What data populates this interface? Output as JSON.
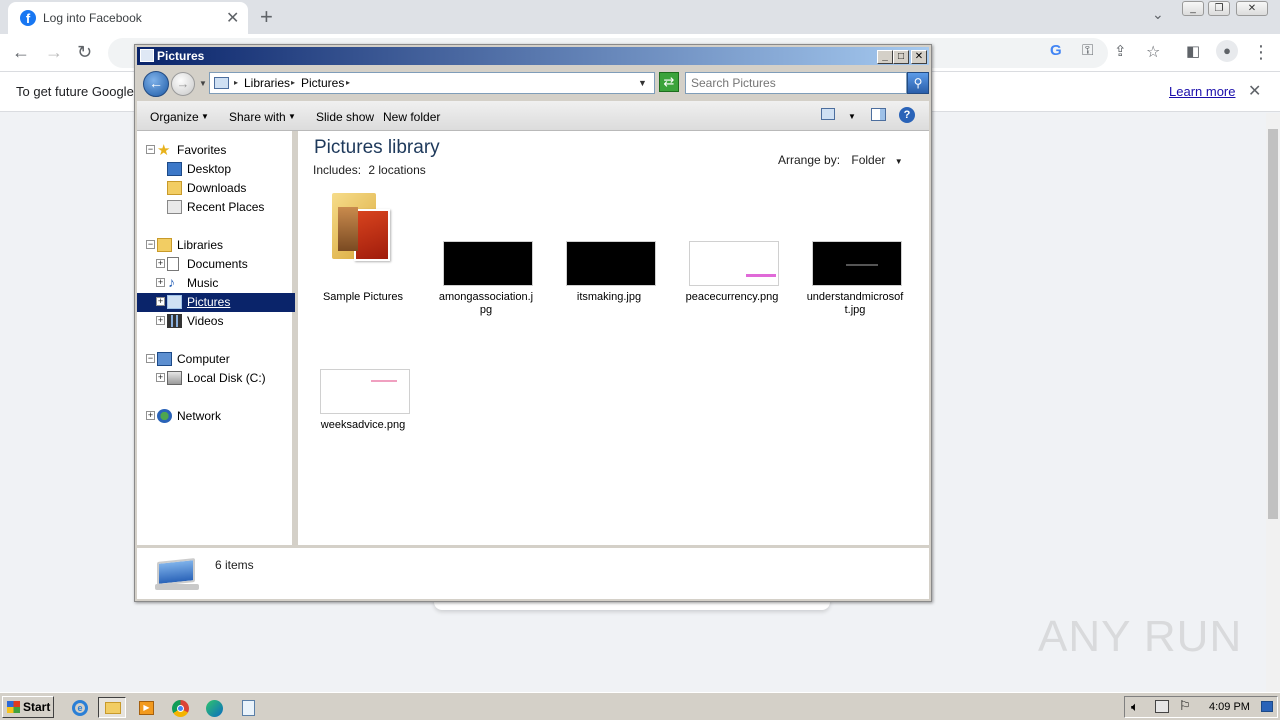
{
  "browser": {
    "tab_title": "Log into Facebook",
    "infobar_message": "To get future Google",
    "infobar_link": "Learn more"
  },
  "explorer": {
    "window_title": "Pictures",
    "breadcrumb": [
      "Libraries",
      "Pictures"
    ],
    "search_placeholder": "Search Pictures",
    "commands": {
      "organize": "Organize",
      "share_with": "Share with",
      "slide_show": "Slide show",
      "new_folder": "New folder"
    },
    "nav": {
      "favorites": "Favorites",
      "desktop": "Desktop",
      "downloads": "Downloads",
      "recent_places": "Recent Places",
      "libraries": "Libraries",
      "documents": "Documents",
      "music": "Music",
      "pictures": "Pictures",
      "videos": "Videos",
      "computer": "Computer",
      "local_disk": "Local Disk (C:)",
      "network": "Network"
    },
    "library_title": "Pictures library",
    "includes_label": "Includes:",
    "includes_value": "2 locations",
    "arrange_label": "Arrange by:",
    "arrange_value": "Folder",
    "items": [
      {
        "name": "Sample Pictures"
      },
      {
        "name": "amongassociation.jpg",
        "name_line1": "amongassociation.j",
        "name_line2": "pg"
      },
      {
        "name": "itsmaking.jpg"
      },
      {
        "name": "peacecurrency.png"
      },
      {
        "name": "understandmicrosoft.jpg",
        "name_line1": "understandmicrosof",
        "name_line2": "t.jpg"
      },
      {
        "name": "weeksadvice.png"
      }
    ],
    "status_count": "6 items"
  },
  "taskbar": {
    "start_label": "Start",
    "clock": "4:09 PM"
  },
  "watermark": "ANY RUN",
  "colors": {
    "titlebar_start": "#0a246a",
    "titlebar_end": "#a6caf0",
    "selection": "#0a246a",
    "facebook_blue": "#1877f2"
  }
}
